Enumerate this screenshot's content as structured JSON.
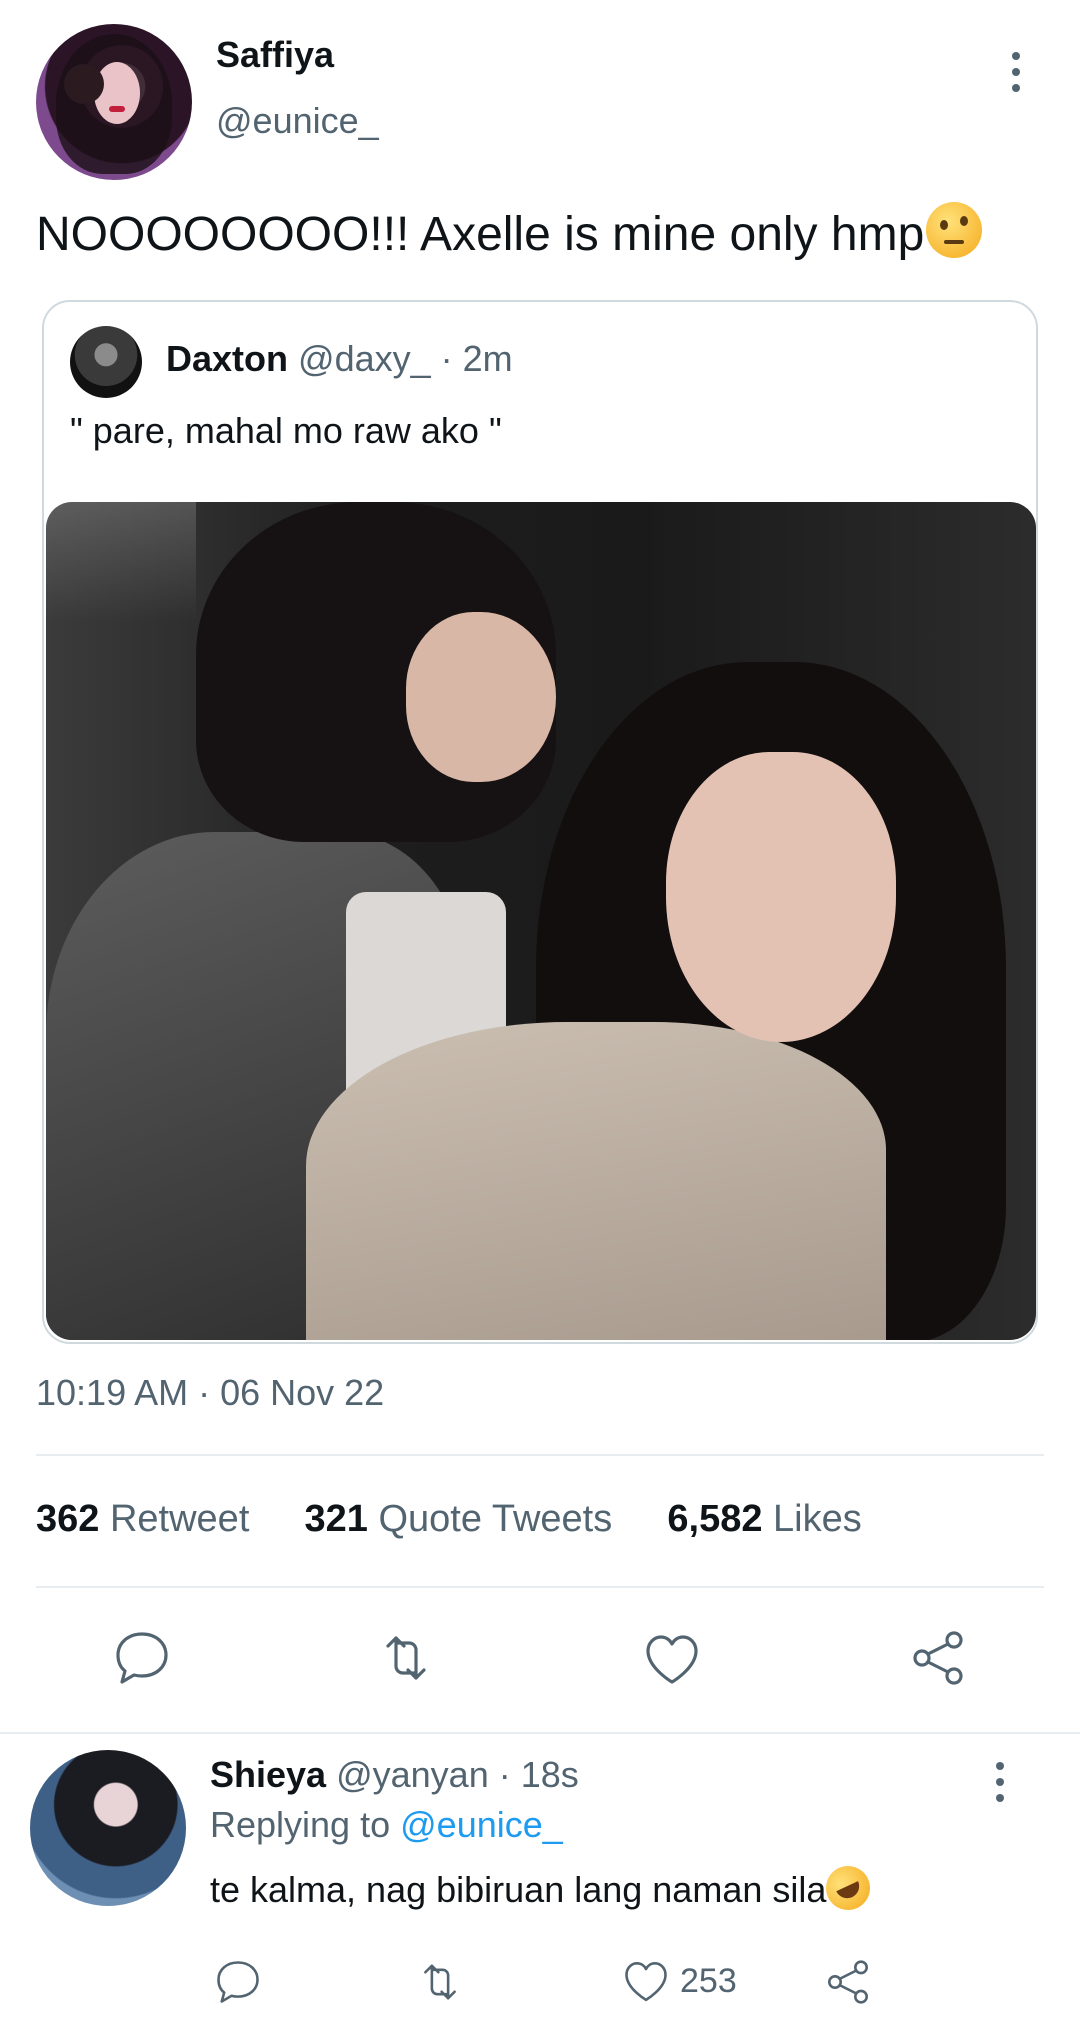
{
  "tweet": {
    "author_name": "Saffiya",
    "author_handle": "@eunice_",
    "text": "NOOOOOOOO!!! Axelle is mine only hmp",
    "emoji": "face-with-raised-eyebrow",
    "timestamp": "10:19 AM · 06 Nov 22",
    "stats": {
      "retweets_count": "362",
      "retweets_label": "Retweet",
      "quotes_count": "321",
      "quotes_label": "Quote Tweets",
      "likes_count": "6,582",
      "likes_label": "Likes"
    }
  },
  "quote": {
    "author_name": "Daxton",
    "author_handle": "@daxy_",
    "time": "· 2m",
    "text": "\" pare, mahal mo raw ako \""
  },
  "reply": {
    "author_name": "Shieya",
    "author_handle": "@yanyan",
    "time": "· 18s",
    "replying_prefix": "Replying to",
    "replying_mention": "@eunice_",
    "text": "te kalma, nag bibiruan lang naman sila",
    "emoji": "rolling-on-the-floor-laughing",
    "like_count": "253"
  },
  "icons": [
    "more-vertical-icon",
    "reply-icon",
    "retweet-icon",
    "like-icon",
    "share-icon"
  ],
  "colors": {
    "text_primary": "#0f1419",
    "text_secondary": "#536471",
    "link": "#1d9bf0",
    "divider": "#e6ecf0",
    "card_border": "#cfd9de"
  }
}
